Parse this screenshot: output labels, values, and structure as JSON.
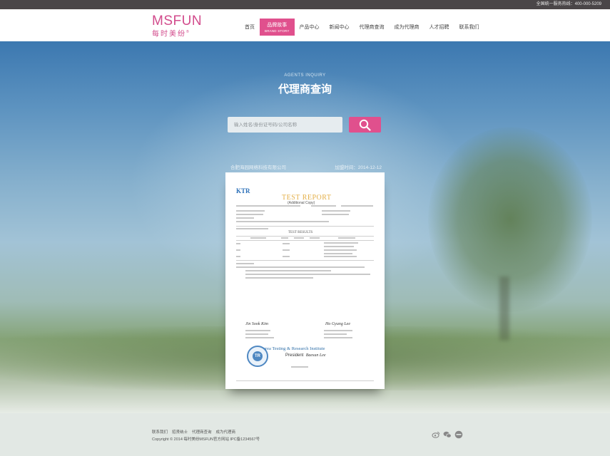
{
  "topbar": {
    "hotline": "全国统一服务热线：400-000-5209"
  },
  "logo": {
    "en": "MSFUN",
    "cn": "每时美纷"
  },
  "nav": {
    "items": [
      {
        "label": "首页"
      },
      {
        "label": "品牌故事",
        "sub": "BRAND STORY"
      },
      {
        "label": "产品中心"
      },
      {
        "label": "新闻中心"
      },
      {
        "label": "代理商查询"
      },
      {
        "label": "成为代理商"
      },
      {
        "label": "人才招聘"
      },
      {
        "label": "联系我们"
      }
    ],
    "active_index": 1
  },
  "section": {
    "title_en": "AGENTS INQUIRY",
    "title_cn": "代理商查询"
  },
  "search": {
    "placeholder": "输入姓名/身份证号码/公司名称"
  },
  "result": {
    "company": "合肥海园网络科技有限公司",
    "date": "加盟时间：2014-12-12"
  },
  "certificate": {
    "title": "TEST REPORT",
    "subtitle": "(Additional Copy)",
    "logo": "KTR",
    "results_heading": "TEST RESULTS",
    "institute": "Korea Testing & Research Institute",
    "president": "President"
  },
  "footer": {
    "links": [
      "联系我们",
      "招贤纳士",
      "代理商查询",
      "成为代理商"
    ],
    "copyright": "Copyright © 2014 每时美纷MSFUN官方网站 IPC备1234567号"
  },
  "social": [
    "weibo-icon",
    "wechat-icon",
    "qq-icon"
  ],
  "colors": {
    "accent": "#e0508d",
    "topbar": "#4a4648",
    "brand": "#d24b8c"
  }
}
